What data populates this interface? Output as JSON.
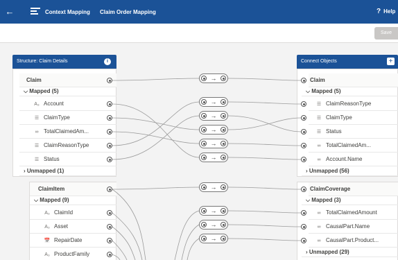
{
  "topbar": {
    "back_icon": "arrow-left-icon",
    "tab1": "Context Mapping",
    "tab2": "Claim Order Mapping",
    "help_mark": "?",
    "help_label": "Help"
  },
  "toolbar": {
    "save_label": "Save"
  },
  "left": {
    "title": "Structure: Claim Details",
    "info_icon": "i",
    "claim": {
      "name": "Claim",
      "mapped": "Mapped (5)",
      "fields": [
        {
          "icon": "A₃",
          "label": "Account"
        },
        {
          "icon": "☰",
          "label": "ClaimType"
        },
        {
          "icon": "∞",
          "label": "TotalClaimedAm..."
        },
        {
          "icon": "☰",
          "label": "ClaimReasonType"
        },
        {
          "icon": "☰",
          "label": "Status"
        }
      ],
      "unmapped": "Unmapped (1)"
    },
    "claimitem": {
      "name": "ClaimItem",
      "mapped": "Mapped (9)",
      "fields": [
        {
          "icon": "A₃",
          "label": "ClaimId"
        },
        {
          "icon": "A₃",
          "label": "Asset"
        },
        {
          "icon": "📅",
          "label": "RepairDate"
        },
        {
          "icon": "A₃",
          "label": "ProductFamily"
        }
      ]
    }
  },
  "right": {
    "title": "Connect Objects",
    "plus": "+",
    "claim": {
      "name": "Claim",
      "mapped": "Mapped (5)",
      "fields": [
        {
          "icon": "☰",
          "label": "ClaimReasonType"
        },
        {
          "icon": "☰",
          "label": "ClaimType"
        },
        {
          "icon": "☰",
          "label": "Status"
        },
        {
          "icon": "∞",
          "label": "TotalClaimedAm..."
        },
        {
          "icon": "∞",
          "label": "Account.Name"
        }
      ],
      "unmapped": "Unmapped (56)"
    },
    "coverage": {
      "name": "ClaimCoverage",
      "mapped": "Mapped (3)",
      "fields": [
        {
          "icon": "∞",
          "label": "TotalClaimedAmount"
        },
        {
          "icon": "∞",
          "label": "CausalPart.Name"
        },
        {
          "icon": "∞",
          "label": "CausalPart.Product..."
        }
      ],
      "unmapped": "Unmapped (29)"
    }
  },
  "node_arrow": "→",
  "colors": {
    "brand": "#1b5297",
    "line": "#9a9a9a"
  }
}
